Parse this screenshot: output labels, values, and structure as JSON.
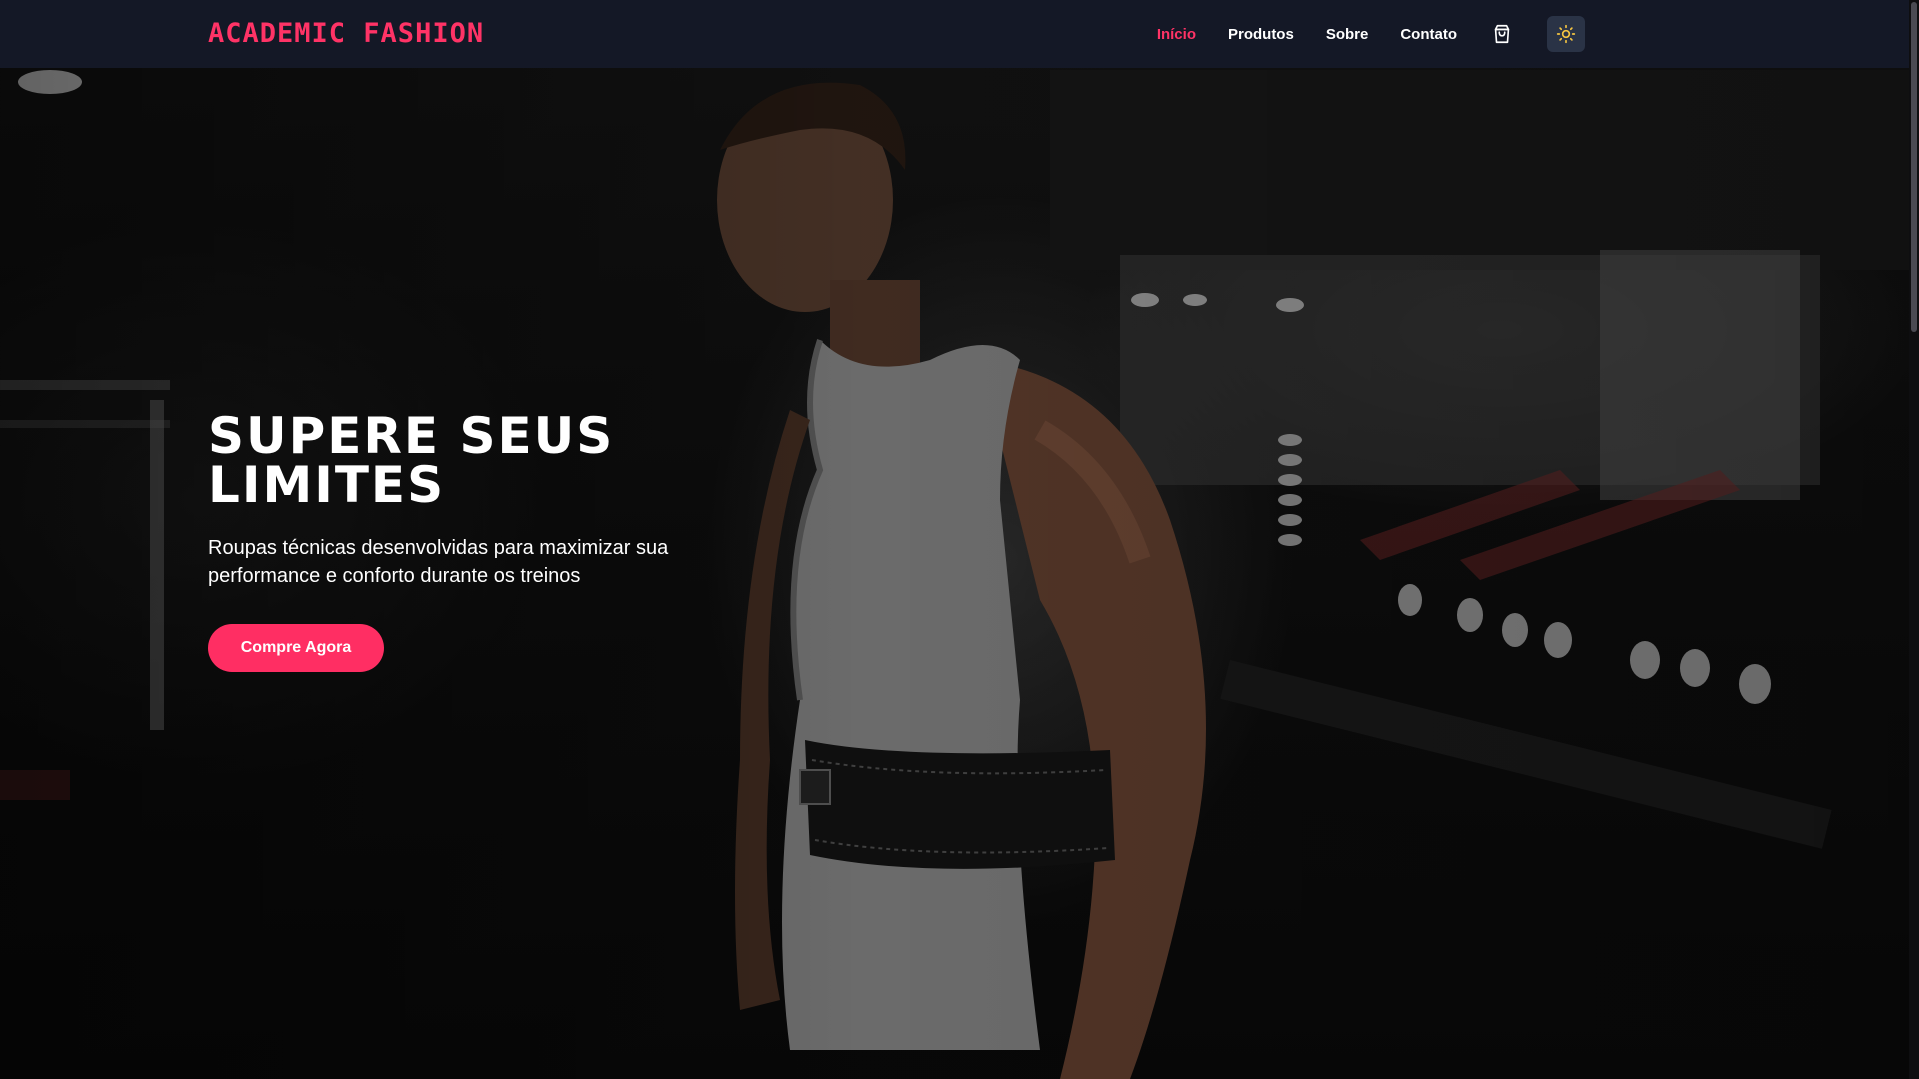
{
  "brand": {
    "name": "ACADEMIC FASHION",
    "color": "#ff3366"
  },
  "nav": {
    "links": [
      {
        "label": "Início",
        "active": true
      },
      {
        "label": "Produtos",
        "active": false
      },
      {
        "label": "Sobre",
        "active": false
      },
      {
        "label": "Contato",
        "active": false
      }
    ],
    "cart_icon": "shopping-bag-icon",
    "theme_icon": "sun-icon"
  },
  "hero": {
    "title": "SUPERE SEUS LIMITES",
    "subtitle": "Roupas técnicas desenvolvidas para maximizar sua performance e conforto durante os treinos",
    "cta_label": "Compre Agora",
    "background_image": "gym-athlete-photo"
  },
  "colors": {
    "accent": "#ff3366",
    "nav_bg": "#141826",
    "theme_button_bg": "#2a3346"
  }
}
